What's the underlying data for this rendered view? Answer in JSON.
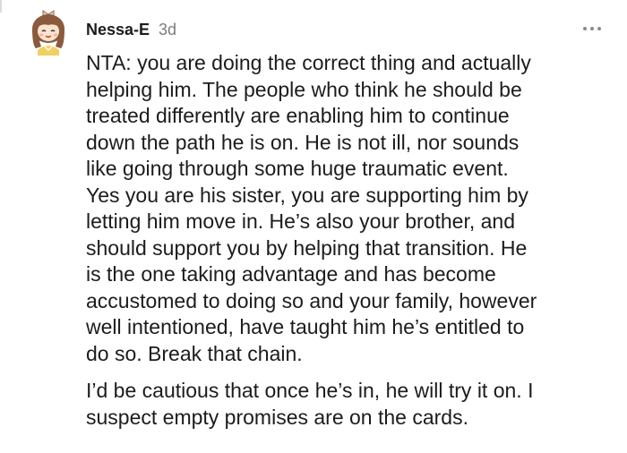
{
  "comment": {
    "author": "Nessa-E",
    "age": "3d",
    "paragraphs": [
      "NTA: you are doing the correct thing and actually\nhelping him. The people who think he should be\ntreated differently are enabling him to continue\ndown the path he is on. He is not ill, nor sounds\nlike going through some huge traumatic event.\nYes you are his sister, you are supporting him by\nletting him move in. He’s also your brother, and\nshould support you by helping that transition. He\nis the one taking advantage and has become\naccustomed to doing so and your family, however\nwell intentioned, have taught him he’s entitled to\ndo so. Break that chain.",
      "I’d be cautious that once he’s in, he will try it on. I\nsuspect empty promises are on the cards."
    ]
  },
  "icons": {
    "avatar": "avatar-icon",
    "more": "more-options-icon"
  },
  "colors": {
    "text": "#1c1c1c",
    "meta": "#7c7c7c",
    "icon": "#878a8c",
    "thread_line": "#d9dcdf"
  }
}
